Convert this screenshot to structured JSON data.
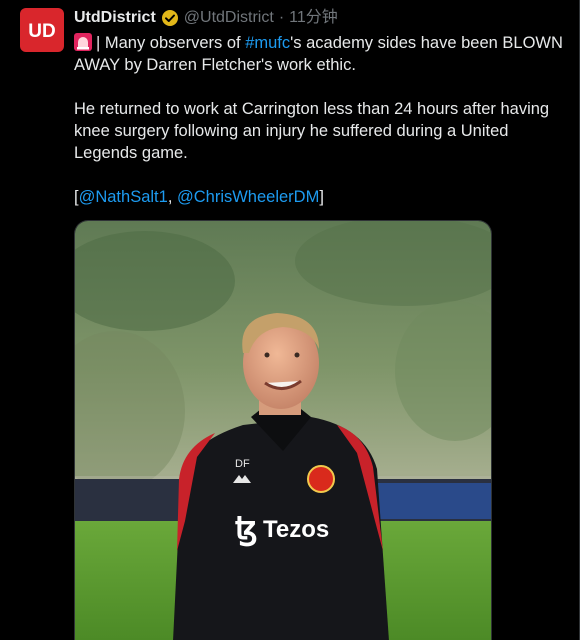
{
  "tweet": {
    "avatar_text": "UD",
    "display_name": "UtdDistrict",
    "handle": "@UtdDistrict",
    "separator": "·",
    "time": "11分钟",
    "siren_emoji": "🚨",
    "line1_pre": "| Many observers of ",
    "hashtag": "#mufc",
    "line1_post": "'s academy sides have been BLOWN AWAY by Darren Fletcher's work ethic.",
    "para2": "He returned to work at Carrington less than 24 hours after having knee surgery following an injury he suffered during a United Legends game.",
    "bracket_open": "[",
    "mention1": "@NathSalt1",
    "comma": ", ",
    "mention2": "@ChrisWheelerDM",
    "bracket_close": "]"
  },
  "photo": {
    "initials": "DF",
    "sponsor": "Tezos"
  },
  "colors": {
    "background": "#000000",
    "text": "#e7e9ea",
    "muted": "#71767b",
    "link": "#1d9bf0",
    "avatar_red": "#d9262c",
    "verified_gold": "#e2b719"
  },
  "icons": {
    "avatar": "utddistrict-logo",
    "verified": "verified-badge-icon",
    "siren": "siren-icon"
  }
}
